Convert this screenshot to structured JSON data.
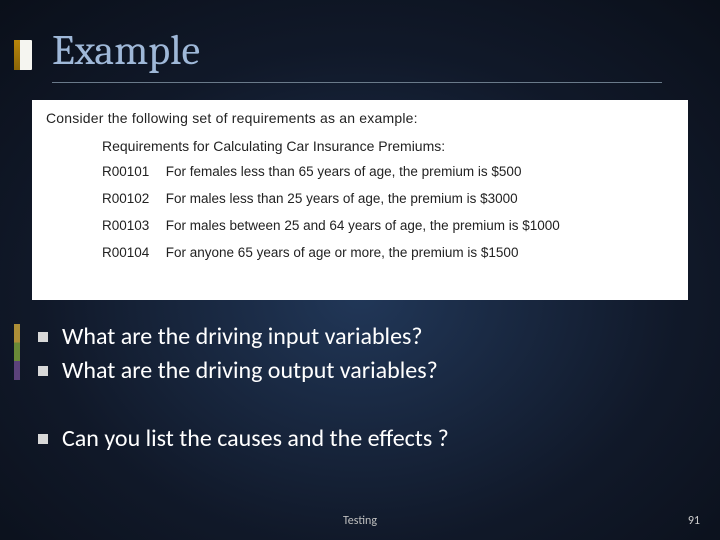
{
  "title": "Example",
  "intro": "Consider the following set of requirements as an example:",
  "subhead": "Requirements for Calculating Car Insurance Premiums:",
  "requirements": [
    {
      "code": "R00101",
      "text": "For females less than 65 years of age, the premium is $500"
    },
    {
      "code": "R00102",
      "text": "For males less than 25 years of age, the premium is $3000"
    },
    {
      "code": "R00103",
      "text": "For males between 25 and 64 years of age, the premium is $1000"
    },
    {
      "code": "R00104",
      "text": "For anyone 65 years of age or more, the premium is $1500"
    }
  ],
  "bullets": [
    "What are the driving input variables?",
    "What are the driving output variables?",
    "Can you list the causes and the effects ?"
  ],
  "footer": "Testing",
  "page": "91"
}
